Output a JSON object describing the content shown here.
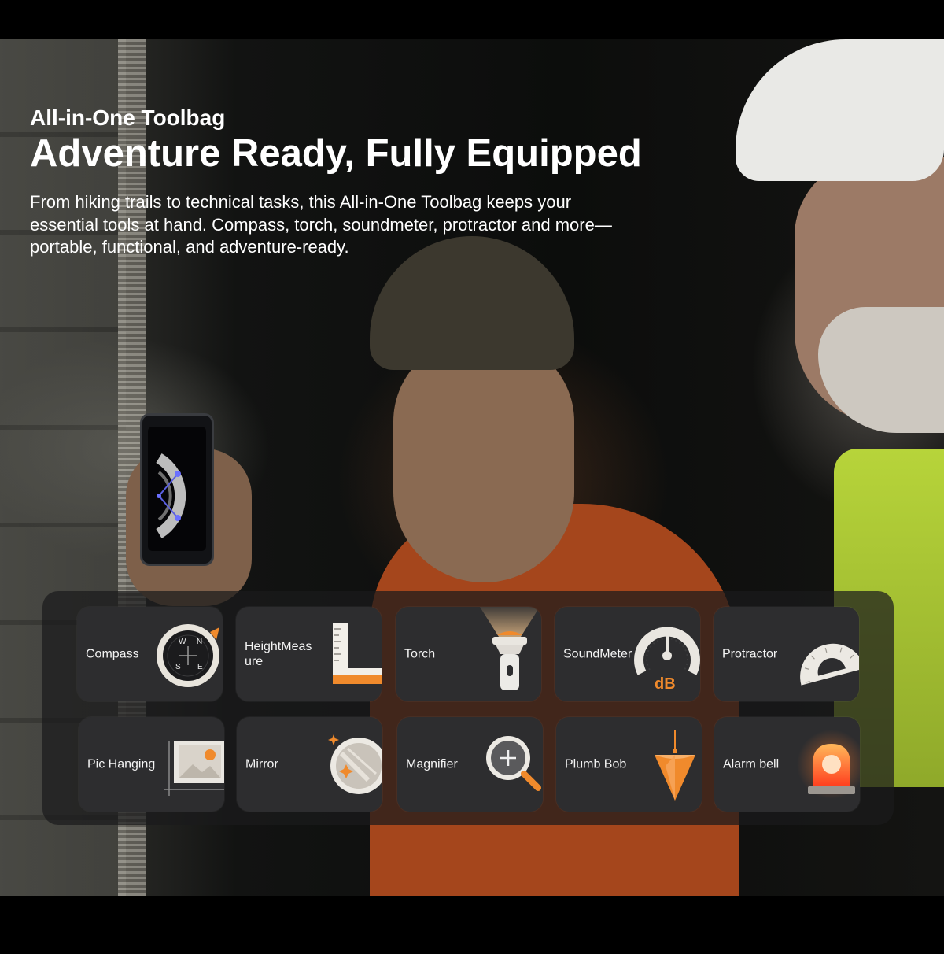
{
  "header": {
    "kicker": "All-in-One Toolbag",
    "headline": "Adventure Ready, Fully Equipped",
    "description": "From hiking trails to technical tasks, this All-in-One Toolbag keeps your essential tools at hand. Compass, torch, soundmeter, protractor and more—portable, functional, and adventure-ready."
  },
  "colors": {
    "accent_orange": "#f08a2c",
    "tile_bg": "#2d2d2f",
    "panel_bg": "#1a1a1c"
  },
  "tools": [
    {
      "label": "Compass",
      "icon": "compass-icon",
      "marks": [
        "W",
        "N",
        "S",
        "E"
      ]
    },
    {
      "label": "HeightMeasure",
      "icon": "height-ruler-icon"
    },
    {
      "label": "Torch",
      "icon": "torch-icon"
    },
    {
      "label": "SoundMeter",
      "icon": "sound-meter-icon",
      "unit": "dB"
    },
    {
      "label": "Protractor",
      "icon": "protractor-icon"
    },
    {
      "label": "Pic Hanging",
      "icon": "picture-frame-icon"
    },
    {
      "label": "Mirror",
      "icon": "mirror-icon"
    },
    {
      "label": "Magnifier",
      "icon": "magnifier-icon"
    },
    {
      "label": "Plumb Bob",
      "icon": "plumb-bob-icon"
    },
    {
      "label": "Alarm bell",
      "icon": "alarm-bell-icon"
    }
  ]
}
